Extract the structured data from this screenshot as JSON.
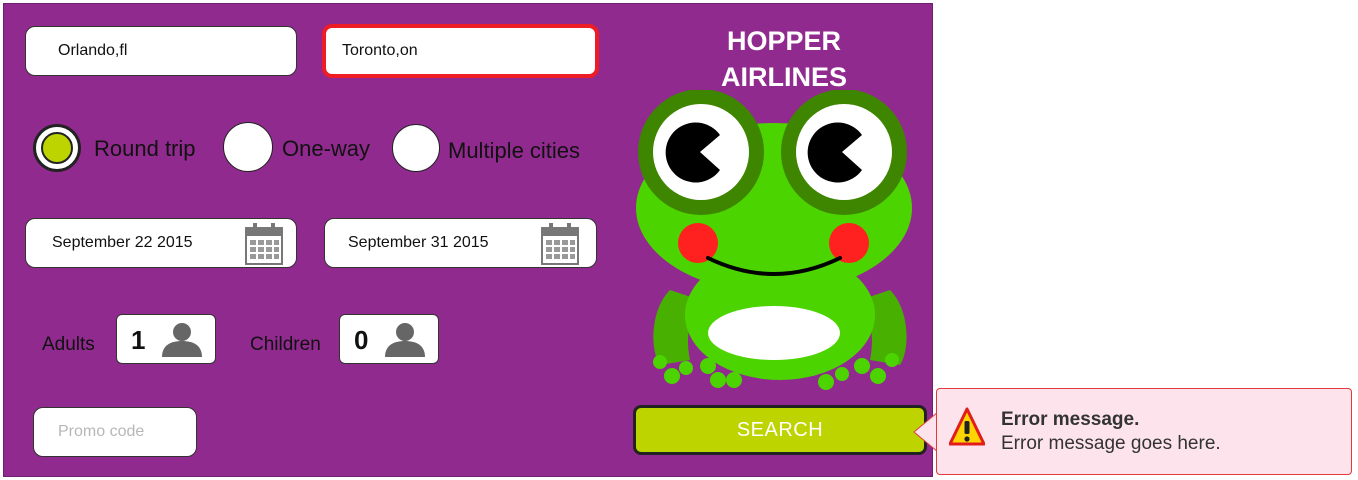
{
  "brand": {
    "line1": "HOPPER",
    "line2": "AIRLINES"
  },
  "origin": {
    "value": "Orlando,fl"
  },
  "destination": {
    "value": "Toronto,on"
  },
  "trip_types": [
    {
      "label": "Round trip",
      "selected": true
    },
    {
      "label": "One-way",
      "selected": false
    },
    {
      "label": "Multiple cities",
      "selected": false
    }
  ],
  "depart_date": {
    "value": "September 22 2015"
  },
  "return_date": {
    "value": "September 31 2015"
  },
  "passengers": {
    "adults_label": "Adults",
    "adults_value": "1",
    "children_label": "Children",
    "children_value": "0"
  },
  "promo": {
    "placeholder": "Promo code"
  },
  "search": {
    "label": "SEARCH"
  },
  "error": {
    "title": "Error message.",
    "text": "Error message goes here."
  },
  "colors": {
    "panel": "#912a8e",
    "accent": "#bdd400",
    "error_border": "#ee1c24",
    "error_bg": "#fde4ec",
    "frog": "#4cd400"
  }
}
